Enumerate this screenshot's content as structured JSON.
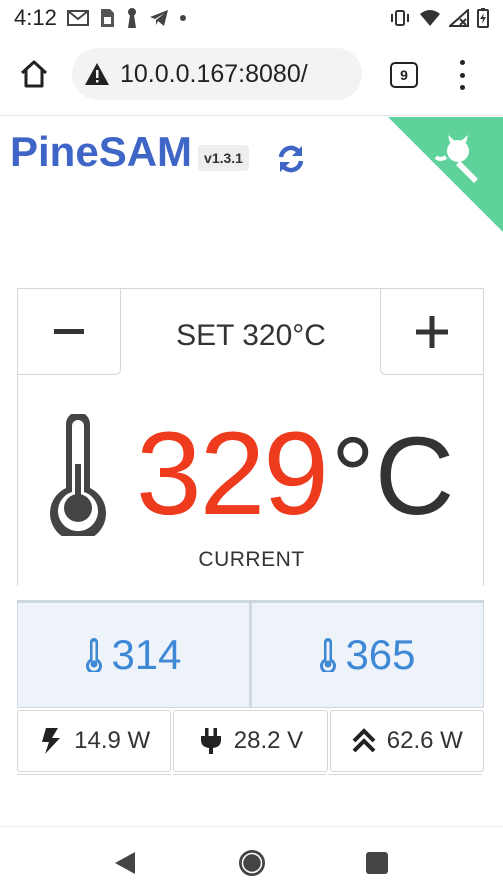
{
  "status_bar": {
    "time": "4:12",
    "left_icons": [
      "gmail-icon",
      "sim-icon",
      "keyhole-icon",
      "telegram-icon",
      "dot-icon"
    ],
    "right_icons": [
      "vibrate-icon",
      "wifi-icon",
      "signal-icon",
      "battery-icon"
    ]
  },
  "browser": {
    "url": "10.0.0.167:8080/",
    "tab_count": "9"
  },
  "app": {
    "title": "PineSAM",
    "version": "v1.3.1"
  },
  "controls": {
    "minus_label": "−",
    "plus_label": "+",
    "setpoint_text": "SET 320°C"
  },
  "temperature": {
    "current_value": "329",
    "unit": "°C",
    "current_label": "CURRENT"
  },
  "limits": {
    "low": "314",
    "high": "365"
  },
  "stats": {
    "power": "14.9 W",
    "voltage": "28.2 V",
    "max_power": "62.6 W"
  },
  "colors": {
    "brand_blue": "#3f66c6",
    "temp_red": "#ee3a1d",
    "limit_blue": "#3f88d6",
    "corner_green": "#5fd19b"
  }
}
